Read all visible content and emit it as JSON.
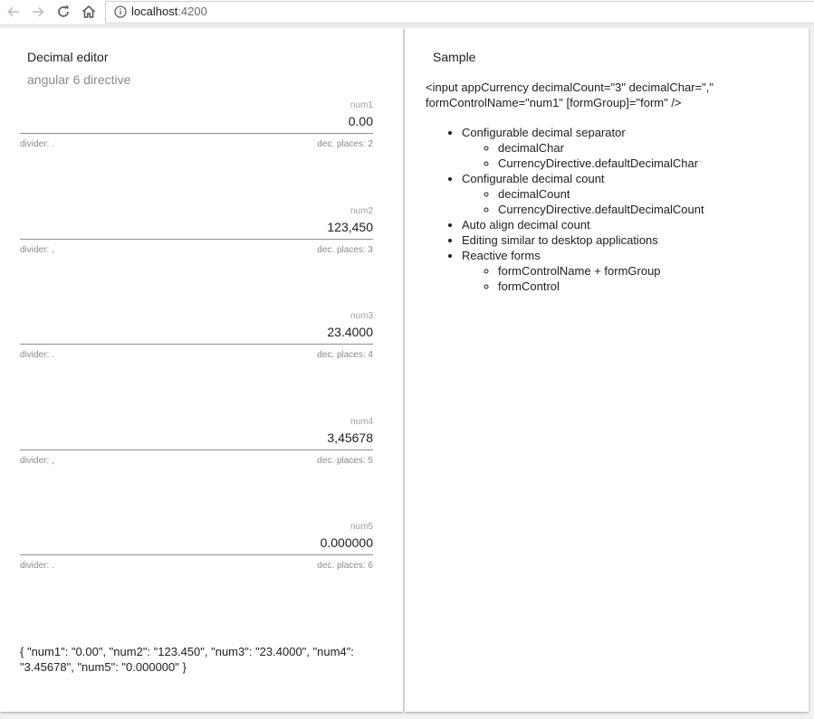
{
  "browser": {
    "url_host": "localhost",
    "url_port": ":4200"
  },
  "left_card": {
    "title": "Decimal editor",
    "subtitle": "angular 6 directive",
    "fields": [
      {
        "label": "num1",
        "value": "0.00",
        "divider": "divider: .",
        "places": "dec. places: 2"
      },
      {
        "label": "num2",
        "value": "123,450",
        "divider": "divider: ,",
        "places": "dec. places: 3"
      },
      {
        "label": "num3",
        "value": "23.4000",
        "divider": "divider: .",
        "places": "dec. places: 4"
      },
      {
        "label": "num4",
        "value": "3,45678",
        "divider": "divider: ,",
        "places": "dec. places: 5"
      },
      {
        "label": "num5",
        "value": "0.000000",
        "divider": "divider: .",
        "places": "dec. places: 6"
      }
    ],
    "json_output": "{ \"num1\": \"0.00\", \"num2\": \"123.450\", \"num3\": \"23.4000\", \"num4\": \"3.45678\", \"num5\": \"0.000000\" }"
  },
  "right_card": {
    "title": "Sample",
    "code": "<input appCurrency decimalCount=\"3\" decimalChar=\",\" formControlName=\"num1\" [formGroup]=\"form\" />",
    "features": [
      {
        "text": "Configurable decimal separator",
        "sub": [
          "decimalChar",
          "CurrencyDirective.defaultDecimalChar"
        ]
      },
      {
        "text": "Configurable decimal count",
        "sub": [
          "decimalCount",
          "CurrencyDirective.defaultDecimalCount"
        ]
      },
      {
        "text": "Auto align decimal count"
      },
      {
        "text": "Editing similar to desktop applications"
      },
      {
        "text": "Reactive forms",
        "sub": [
          "formControlName + formGroup",
          "formControl"
        ]
      }
    ]
  },
  "icons": {
    "back": "back-arrow-icon",
    "forward": "forward-arrow-icon",
    "reload": "reload-icon",
    "home": "home-icon",
    "info": "info-icon"
  },
  "colors": {
    "page_bg": "#f1f1f1",
    "card_bg": "#ffffff",
    "underline": "#8f8f8f",
    "hint_text": "#8a8a8a"
  }
}
